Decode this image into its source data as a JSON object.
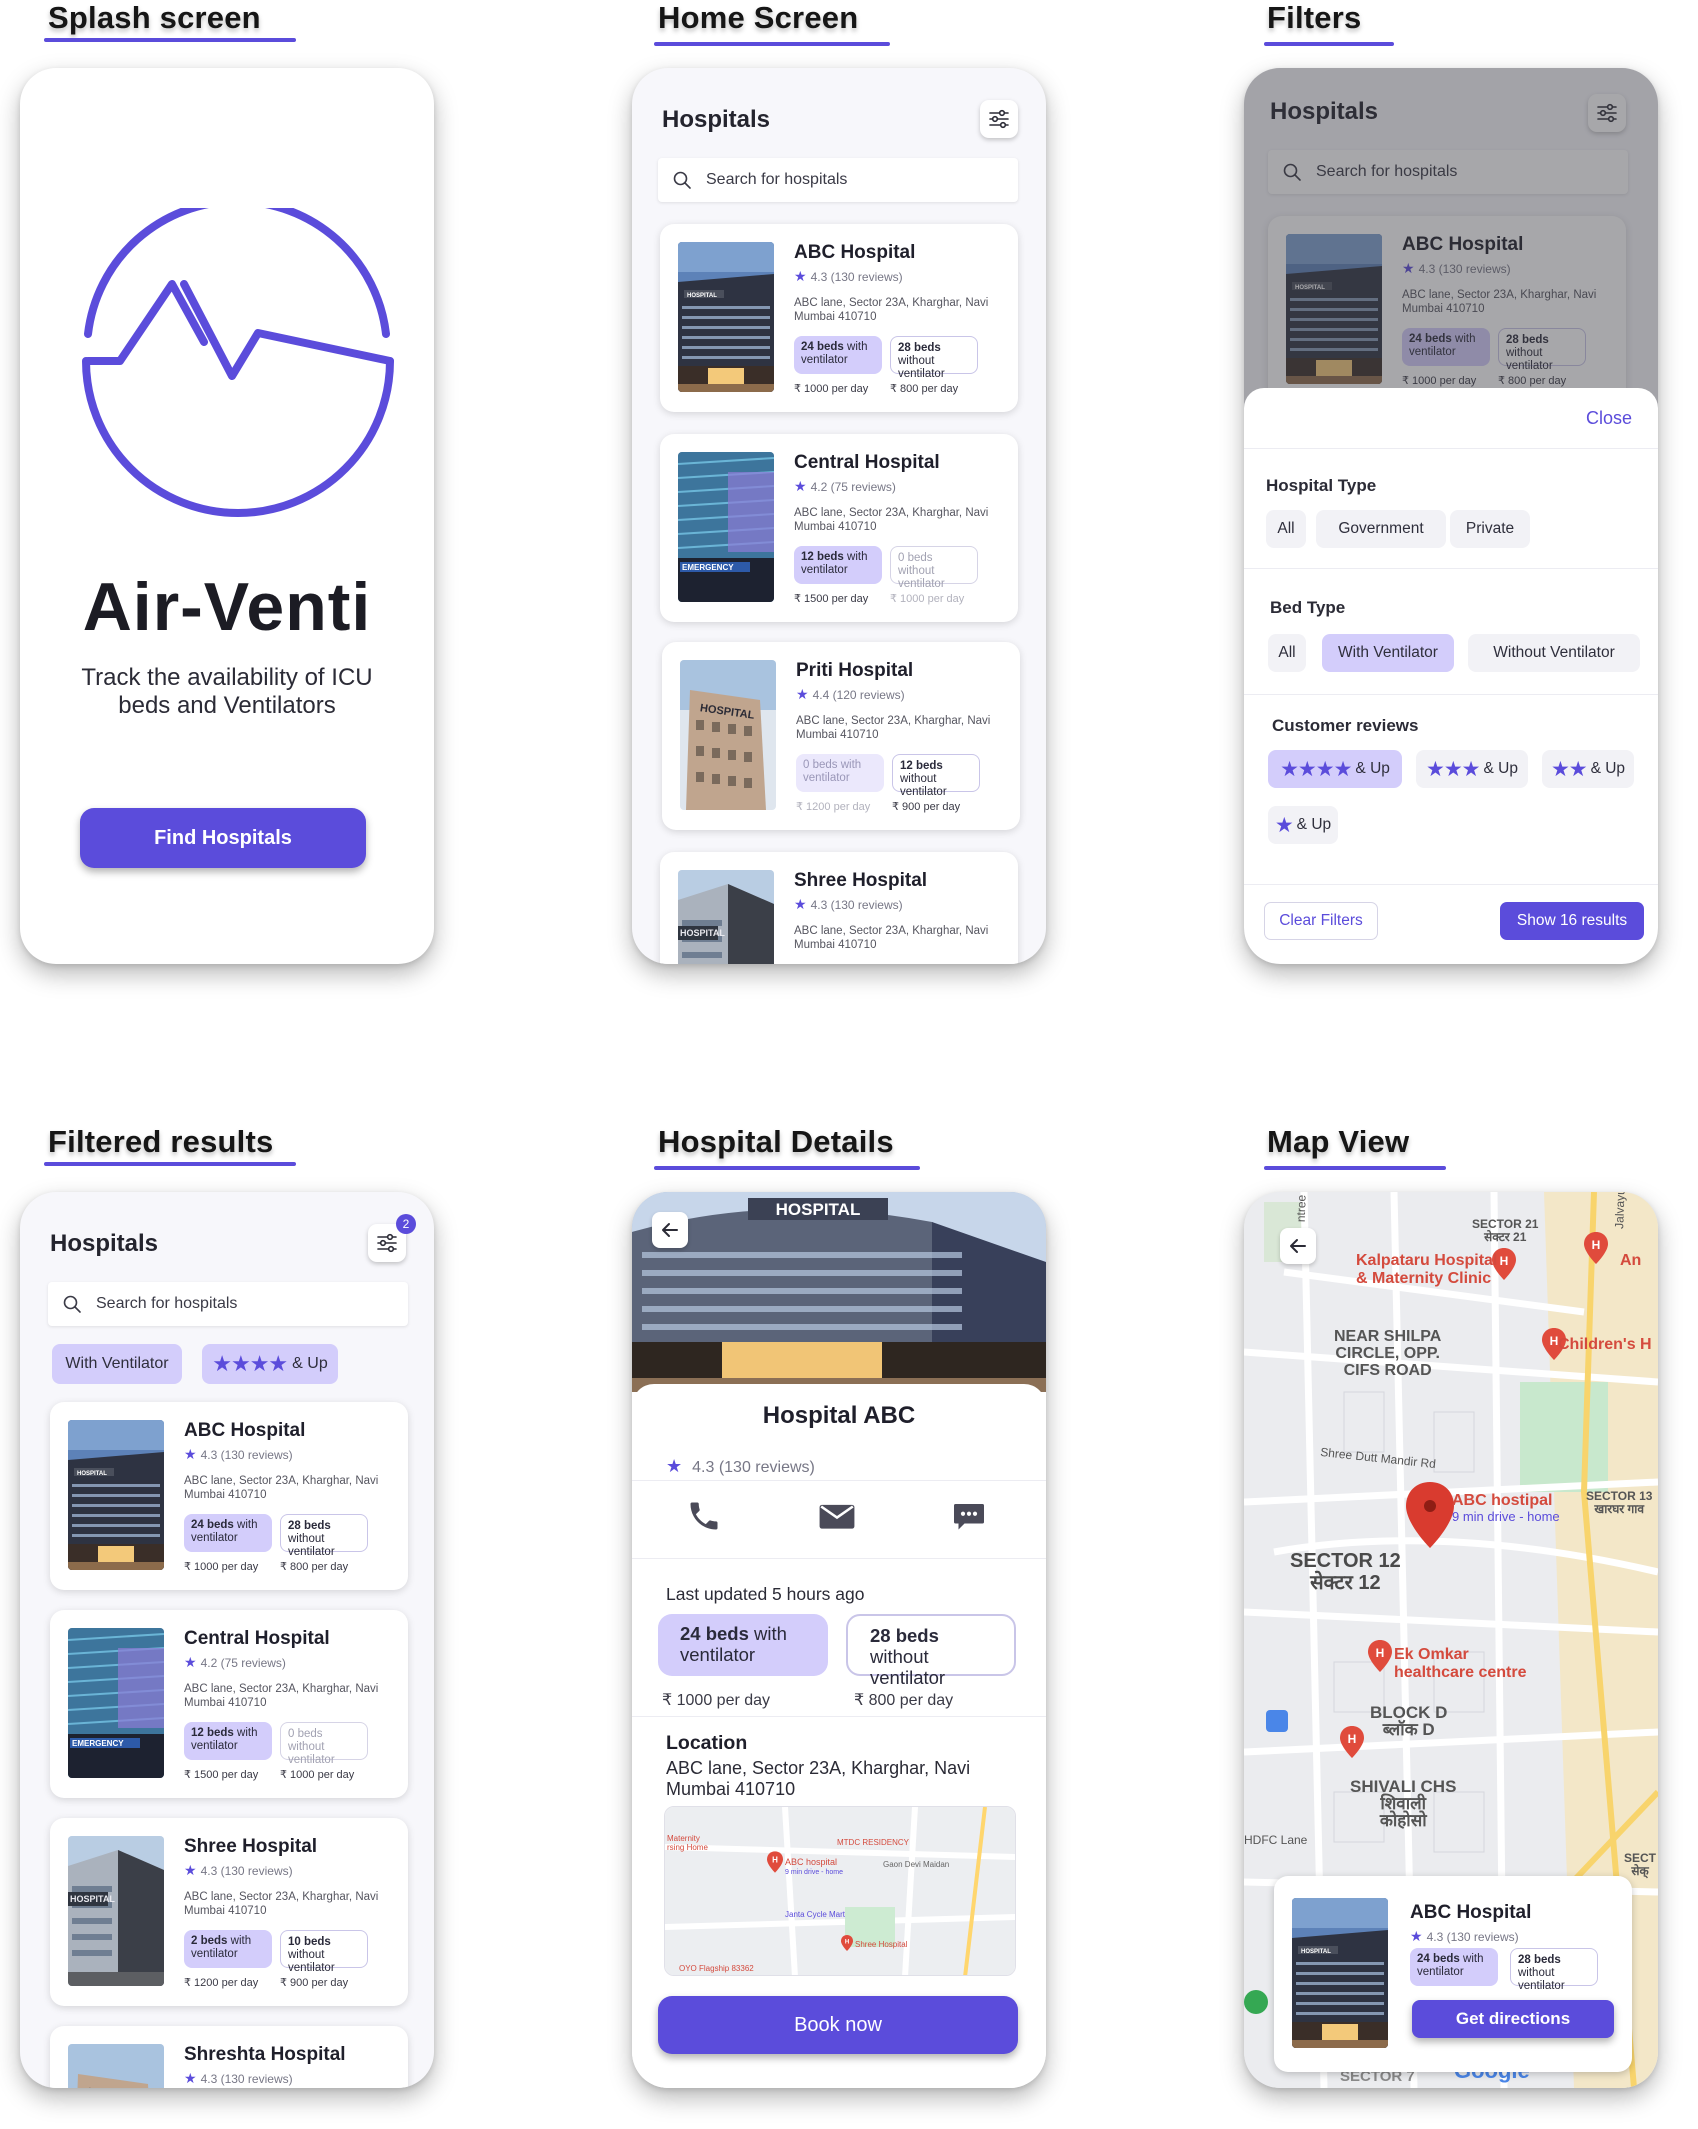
{
  "sections": {
    "splash": "Splash screen",
    "home": "Home Screen",
    "filters": "Filters",
    "filtered": "Filtered results",
    "details": "Hospital Details",
    "map": "Map View"
  },
  "app": {
    "name": "Air-Venti",
    "tagline": "Track the availability of ICU beds and Ventilators",
    "cta": "Find Hospitals"
  },
  "list": {
    "title": "Hospitals",
    "search_placeholder": "Search for hospitals"
  },
  "hospitals": [
    {
      "name": "ABC Hospital",
      "rating": "4.3 (130 reviews)",
      "address": "ABC lane, Sector 23A,  Kharghar, Navi Mumbai 410710",
      "with_bold": "24 beds",
      "with_rest": " with ventilator",
      "without_bold": "28 beds",
      "without_rest": " without ventilator",
      "with_price": "₹ 1000 per day",
      "without_price": "₹ 800 per day"
    },
    {
      "name": "Central Hospital",
      "rating": "4.2 (75 reviews)",
      "address": "ABC lane, Sector 23A,  Kharghar, Navi Mumbai 410710",
      "with_bold": "12 beds",
      "with_rest": " with ventilator",
      "without_bold": "0 beds",
      "without_rest": " without ventilator",
      "with_price": "₹ 1500 per day",
      "without_price": "₹ 1000 per day"
    },
    {
      "name": "Priti Hospital",
      "rating": "4.4 (120 reviews)",
      "address": "ABC lane, Sector 23A,  Kharghar, Navi Mumbai 410710",
      "with_bold": "0 beds",
      "with_rest": " with ventilator",
      "without_bold": "12 beds",
      "without_rest": " without ventilator",
      "with_price": "₹ 1200 per day",
      "without_price": "₹ 900 per day"
    },
    {
      "name": "Shree Hospital",
      "rating": "4.3 (130 reviews)",
      "address": "ABC lane, Sector 23A,  Kharghar, Navi Mumbai 410710",
      "with_bold": "2 beds",
      "with_rest": " with ventilator",
      "without_bold": "10 beds",
      "without_rest": " without ventilator",
      "with_price": "₹ 1200 per day",
      "without_price": "₹ 900 per day"
    },
    {
      "name": "Shreshta Hospital",
      "rating": "4.3 (130 reviews)"
    }
  ],
  "filters": {
    "close": "Close",
    "hospital_type_label": "Hospital Type",
    "hospital_types": [
      "All",
      "Government",
      "Private"
    ],
    "bed_type_label": "Bed Type",
    "bed_types": [
      "All",
      "With Ventilator",
      "Without Ventilator"
    ],
    "reviews_label": "Customer  reviews",
    "review_options": [
      {
        "stars": "★★★★",
        "label": "& Up"
      },
      {
        "stars": "★★★",
        "label": "& Up"
      },
      {
        "stars": "★★",
        "label": "& Up"
      },
      {
        "stars": "★",
        "label": "& Up"
      }
    ],
    "clear": "Clear Filters",
    "show": "Show 16 results"
  },
  "filtered": {
    "badge": "2",
    "tag_ventilator": "With Ventilator",
    "tag_stars": "★★★★",
    "tag_up": "& Up"
  },
  "details": {
    "name": "Hospital ABC",
    "rating": "4.3 (130 reviews)",
    "updated": "Last updated 5 hours ago",
    "with_bold": "24 beds",
    "with_rest": " with ventilator",
    "without_bold": "28 beds",
    "without_rest": " without ventilator",
    "with_price": "₹ 1000 per day",
    "without_price": "₹ 800 per day",
    "location_title": "Location",
    "location_address": "ABC lane, Sector 23A,  Kharghar, Navi Mumbai 410710",
    "book": "Book  now",
    "hero_sign": "HOSPITAL",
    "minimap": {
      "maternity": "Maternity\nrsing Home",
      "mtdc": "MTDC RESIDENCY",
      "abc": "ABC hospital",
      "abc_sub": "9 min drive - home",
      "gaon": "Gaon Devi Maidan",
      "cycle": "Janta Cycle Mart",
      "shree": "Shree Hospital",
      "oyo": "OYO Flagship 83362"
    }
  },
  "map": {
    "labels": {
      "sector21": "SECTOR 21\nसेक्टर 21",
      "kalpataru": "Kalpataru Hospital\n& Maternity Clinic",
      "near": "NEAR SHILPA\nCIRCLE, OPP.\nCIFS ROAD",
      "childrens": "Children's H",
      "road": "Shree Dutt Mandir Rd",
      "abc": "ABC hostipal",
      "abc_sub": "9 min drive - home",
      "sector13": "SECTOR 13\nखारघर गाव",
      "sector12": "SECTOR 12\nसेक्टर 12",
      "ekomkar": "Ek Omkar\nhealthcare centre",
      "blockd": "BLOCK D\nब्लॉक D",
      "shivali": "SHIVALI CHS\nशिवाली\nकोहोसो",
      "hdfc": "HDFC Lane",
      "google": "Google",
      "jalvayu": "Jalvayu",
      "an": "An",
      "ntree": "ntree",
      "sect": "SECT\nसेक्",
      "sector7": "SECTOR 7"
    },
    "card": {
      "name": "ABC Hospital",
      "rating": "4.3 (130 reviews)",
      "with_bold": "24 beds",
      "with_rest": " with ventilator",
      "without_bold": "28 beds",
      "without_rest": " without ventilator",
      "cta": "Get directions"
    }
  },
  "colors": {
    "accent": "#5b4cdb",
    "accent_light": "#d3cdfb"
  }
}
